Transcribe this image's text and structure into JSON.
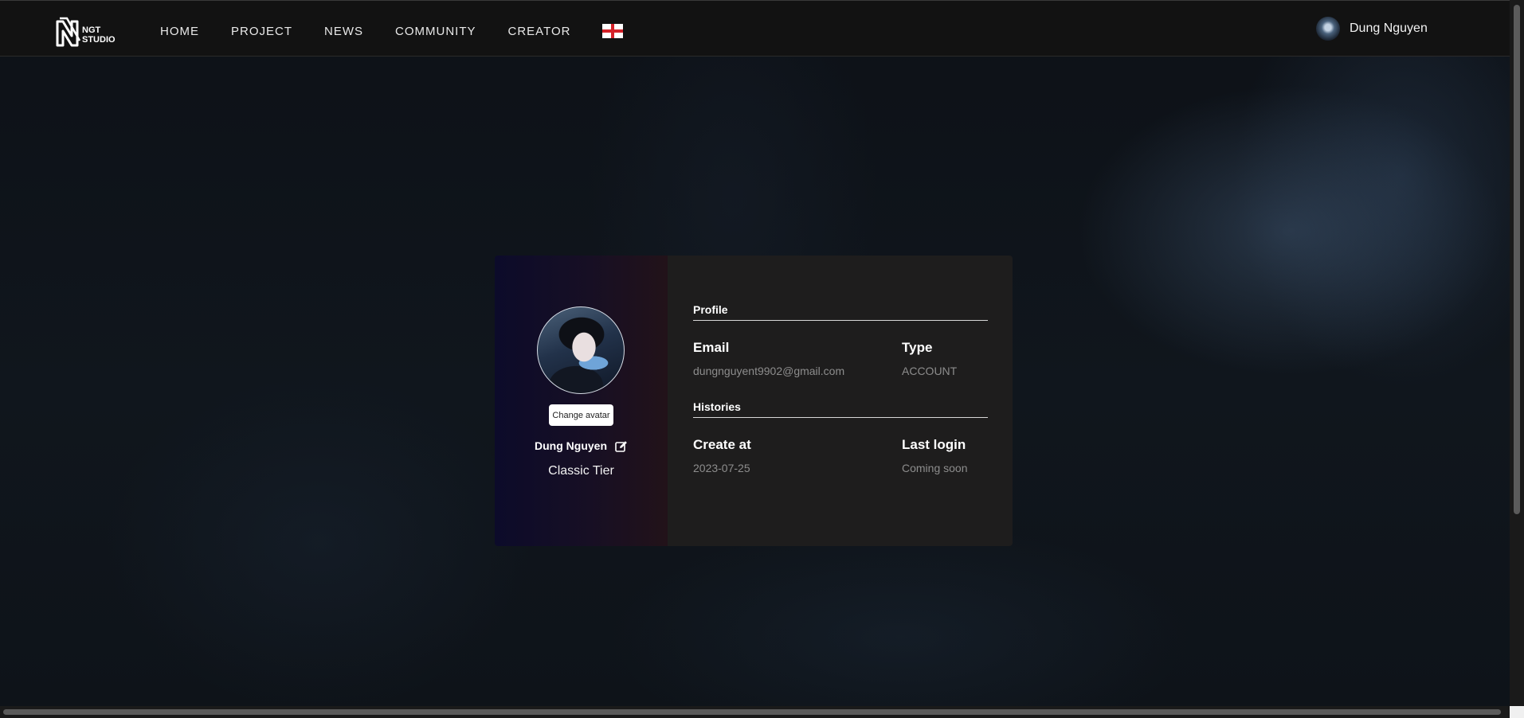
{
  "brand": {
    "logo_text_line1": "NGT",
    "logo_text_line2": "STUDIO"
  },
  "nav": {
    "items": [
      {
        "label": "HOME"
      },
      {
        "label": "PROJECT"
      },
      {
        "label": "NEWS"
      },
      {
        "label": "COMMUNITY"
      },
      {
        "label": "CREATOR"
      }
    ],
    "language_icon": "england-flag-icon"
  },
  "user_menu": {
    "name": "Dung Nguyen",
    "avatar_icon": "user-avatar"
  },
  "profile_card": {
    "change_avatar_label": "Change avatar",
    "display_name": "Dung Nguyen",
    "edit_icon": "edit-icon",
    "tier": "Classic Tier",
    "profile_section": {
      "title": "Profile",
      "email_label": "Email",
      "email_value": "dungnguyent9902@gmail.com",
      "type_label": "Type",
      "type_value": "ACCOUNT"
    },
    "histories_section": {
      "title": "Histories",
      "created_label": "Create at",
      "created_value": "2023-07-25",
      "last_login_label": "Last login",
      "last_login_value": "Coming soon"
    }
  },
  "colors": {
    "header_bg": "#121212",
    "card_left_gradient_start": "#0c0b2a",
    "card_left_gradient_end": "#221219",
    "card_right_bg": "#1e1d1d",
    "muted_text": "#8d8d8d",
    "flag_red": "#d42128"
  }
}
